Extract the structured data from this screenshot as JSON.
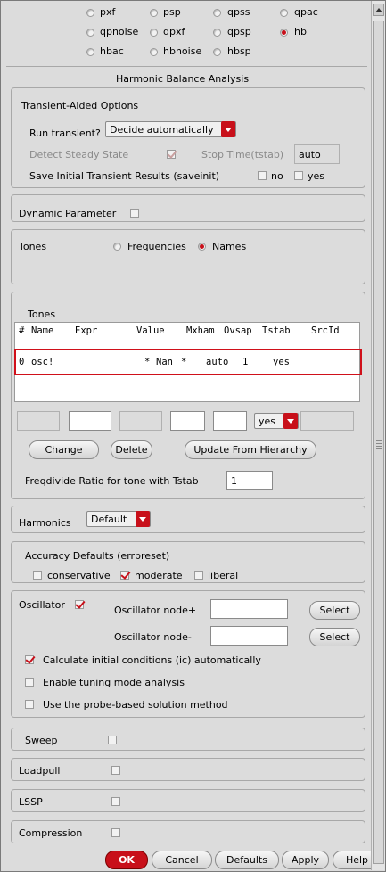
{
  "analysis_types": [
    {
      "name": "pxf",
      "selected": false
    },
    {
      "name": "psp",
      "selected": false
    },
    {
      "name": "qpss",
      "selected": false
    },
    {
      "name": "qpac",
      "selected": false
    },
    {
      "name": "qpnoise",
      "selected": false
    },
    {
      "name": "qpxf",
      "selected": false
    },
    {
      "name": "qpsp",
      "selected": false
    },
    {
      "name": "hb",
      "selected": true
    },
    {
      "name": "hbac",
      "selected": false
    },
    {
      "name": "hbnoise",
      "selected": false
    },
    {
      "name": "hbsp",
      "selected": false
    }
  ],
  "section_title": "Harmonic Balance Analysis",
  "transient": {
    "title": "Transient-Aided Options",
    "run_label": "Run transient?",
    "run_value": "Decide automatically",
    "detect_label": "Detect Steady State",
    "detect_checked": true,
    "stop_label": "Stop Time(tstab)",
    "stop_value": "auto",
    "save_label": "Save Initial Transient Results (saveinit)",
    "save_no": "no",
    "save_yes": "yes"
  },
  "dynamic_param": {
    "label": "Dynamic Parameter",
    "checked": false
  },
  "tones_mode": {
    "label": "Tones",
    "frequencies": "Frequencies",
    "names": "Names",
    "selected": "Names"
  },
  "tones_table": {
    "title": "Tones",
    "headers": [
      "#",
      "Name",
      "Expr",
      "Value",
      "Mxham",
      "Ovsap",
      "Tstab",
      "SrcId"
    ],
    "rows": [
      {
        "num": "0",
        "name": "osc!",
        "expr": "*",
        "value": "Nan",
        "mxham": "*",
        "ovsap": "auto",
        "tstab": "1",
        "srcid": "yes"
      }
    ],
    "edit_select": "yes",
    "change_label": "Change",
    "delete_label": "Delete",
    "update_label": "Update From Hierarchy",
    "freqdivide_label": "Freqdivide Ratio for tone with Tstab",
    "freqdivide_value": "1"
  },
  "harmonics": {
    "label": "Harmonics",
    "value": "Default"
  },
  "accuracy": {
    "title": "Accuracy Defaults (errpreset)",
    "conservative": "conservative",
    "moderate": "moderate",
    "liberal": "liberal",
    "selected": "moderate"
  },
  "oscillator": {
    "label": "Oscillator",
    "checked": true,
    "node_plus_label": "Oscillator node+",
    "node_minus_label": "Oscillator node-",
    "select_label": "Select",
    "ic_label": "Calculate initial conditions (ic) automatically",
    "ic_checked": true,
    "tuning_label": "Enable tuning mode analysis",
    "probe_label": "Use the probe-based solution method"
  },
  "options": [
    {
      "label": "Sweep",
      "checked": false
    },
    {
      "label": "Loadpull",
      "checked": false
    },
    {
      "label": "LSSP",
      "checked": false
    },
    {
      "label": "Compression",
      "checked": false
    }
  ],
  "buttons": {
    "ok": "OK",
    "cancel": "Cancel",
    "defaults": "Defaults",
    "apply": "Apply",
    "help": "Help"
  },
  "colors": {
    "accent": "#c8101a",
    "background": "#dcdcdc",
    "highlight": "#d0101a"
  }
}
